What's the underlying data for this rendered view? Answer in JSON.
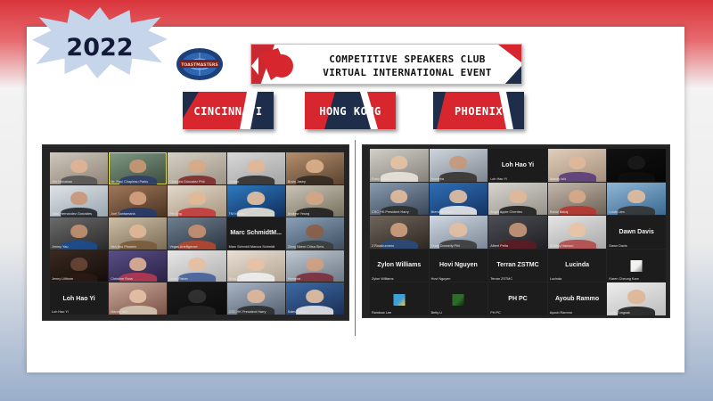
{
  "year": "2022",
  "banner": {
    "line1": "COMPETITIVE SPEAKERS CLUB",
    "line2": "VIRTUAL INTERNATIONAL EVENT"
  },
  "logo_text": "TOASTMASTERS",
  "cities": [
    "CINCINNATI",
    "HONG KONG",
    "PHOENIX"
  ],
  "colors": {
    "red": "#d7262e",
    "navy": "#1e2d4a",
    "dark": "#242424"
  },
  "left_grid": {
    "columns": 5,
    "tiles": [
      {
        "type": "video",
        "caption": "Jim Hinnahan",
        "c1": "#cfc8bd",
        "c2": "#8f8376",
        "sk": "#e0b493",
        "sh": "#555"
      },
      {
        "type": "video",
        "caption": "Mr. Paul Chapleau Parks",
        "c1": "#7f9a84",
        "c2": "#3c4b3e",
        "sk": "#c99873",
        "sh": "#2c3e6a",
        "active": true
      },
      {
        "type": "video",
        "caption": "Chandra Gonzalez Phil",
        "c1": "#d6d0c4",
        "c2": "#9b9385",
        "sk": "#d8aa86",
        "sh": "#7d2a2a"
      },
      {
        "type": "video",
        "caption": "Jordan",
        "c1": "#d8d8d8",
        "c2": "#a3a3a3",
        "sk": "#e2b796",
        "sh": "#2f2f2f"
      },
      {
        "type": "video",
        "caption": "Bram Jasey",
        "c1": "#b58f6c",
        "c2": "#5a4330",
        "sk": "#ddb08d",
        "sh": "#332a22"
      },
      {
        "type": "video",
        "caption": "Nikki Hernandez Gonzales",
        "c1": "#dfe3e6",
        "c2": "#9aa6b0",
        "sk": "#c99577",
        "sh": "#20232b"
      },
      {
        "type": "video",
        "caption": "Joel Santamaria",
        "c1": "#a0785a",
        "c2": "#4a3322",
        "sk": "#d7a282",
        "sh": "#253b6a"
      },
      {
        "type": "video",
        "caption": "Pei Eng",
        "c1": "#e2d8cb",
        "c2": "#a8977f",
        "sk": "#e2b996",
        "sh": "#c23a3a"
      },
      {
        "type": "video",
        "caption": "TM Nanda",
        "c1": "#2f7ac1",
        "c2": "#0f2d5a",
        "sk": "#e8c2a0",
        "sh": "#e8e3d6"
      },
      {
        "type": "video",
        "caption": "Andrew Yeung",
        "c1": "#c9c4b7",
        "c2": "#77715f",
        "sk": "#d4a685",
        "sh": "#1f1f1f"
      },
      {
        "type": "video",
        "caption": "Jimmy Yau",
        "c1": "#6b6b6b",
        "c2": "#2a2a2a",
        "sk": "#c59271",
        "sh": "#1b4b8f"
      },
      {
        "type": "video",
        "caption": "Ven Wui Phoenix",
        "c1": "#cdbfa8",
        "c2": "#7a6b55",
        "sk": "#e2b898",
        "sh": "#7a5a3a"
      },
      {
        "type": "video",
        "caption": "Vegas Artelligence",
        "c1": "#6f7f8f",
        "c2": "#2b3440",
        "sk": "#c99171",
        "sh": "#b6462f"
      },
      {
        "type": "name",
        "big": "Marc SchmidtM...",
        "caption": "Marc Schmidt Marcus Schmidt"
      },
      {
        "type": "video",
        "caption": "Zinny Nkem Chisa Sims",
        "c1": "#8aa1b8",
        "c2": "#3e4e60",
        "sk": "#8c5e45",
        "sh": "#3b3b3b"
      },
      {
        "type": "video",
        "caption": "Jenny Lillitone",
        "c1": "#3a2a22",
        "c2": "#140c08",
        "sk": "#6a4636",
        "sh": "#2a1a14"
      },
      {
        "type": "video",
        "caption": "Christine Ross",
        "c1": "#5a4f86",
        "c2": "#2a2146",
        "sk": "#e0b396",
        "sh": "#b53a52"
      },
      {
        "type": "video",
        "caption": "Brian Fisher",
        "c1": "#e7e7e7",
        "c2": "#b0b0b0",
        "sk": "#e5bfa0",
        "sh": "#425f9a"
      },
      {
        "type": "video",
        "caption": "Ruby Sung",
        "c1": "#e9dfd3",
        "c2": "#b3a594",
        "sk": "#e8c2a4",
        "sh": "#f0f0f0"
      },
      {
        "type": "video",
        "caption": "Homeira",
        "c1": "#bfc9d3",
        "c2": "#6d7985",
        "sk": "#d0a080",
        "sh": "#7c2d3a"
      },
      {
        "type": "name",
        "big": "Loh Hao Yi",
        "caption": "Loh Hao Yi"
      },
      {
        "type": "video",
        "caption": "Mandy Ishi",
        "c1": "#caa79a",
        "c2": "#7a5347",
        "sk": "#e8c2a4",
        "sh": "#d6c6b5"
      },
      {
        "type": "video",
        "caption": "",
        "c1": "#1a1a1a",
        "c2": "#0c0c0c",
        "sk": "#333",
        "sh": "#222"
      },
      {
        "type": "video",
        "caption": "CSC HK President Harry",
        "c1": "#a9b4c4",
        "c2": "#566272",
        "sk": "#e0b89a",
        "sh": "#2b2b2b"
      },
      {
        "type": "video",
        "caption": "Salmon Wilbe",
        "c1": "#3e6aa6",
        "c2": "#1a2f55",
        "sk": "#e7c2a2",
        "sh": "#e6e6e6"
      }
    ]
  },
  "right_grid": {
    "columns": 5,
    "tiles": [
      {
        "type": "video",
        "caption": "Ruby Sung",
        "c1": "#d2cfc9",
        "c2": "#86827b",
        "sk": "#e7c2a2",
        "sh": "#e9e4da"
      },
      {
        "type": "video",
        "caption": "Homeira",
        "c1": "#cfd5dc",
        "c2": "#7d8690",
        "sk": "#c7987a",
        "sh": "#36332f"
      },
      {
        "type": "name",
        "big": "Loh Hao Yi",
        "caption": "Loh Hao Yi"
      },
      {
        "type": "video",
        "caption": "Mandy Ishi",
        "c1": "#e0cdbb",
        "c2": "#a58f7a",
        "sk": "#e0b89a",
        "sh": "#5a3b7a"
      },
      {
        "type": "video",
        "caption": "",
        "c1": "#111",
        "c2": "#050505",
        "sk": "#1a1a1a",
        "sh": "#101010"
      },
      {
        "type": "video",
        "caption": "CSC HK President Harry",
        "c1": "#8a9bb0",
        "c2": "#3a4658",
        "sk": "#e3bc9c",
        "sh": "#2c2c2c"
      },
      {
        "type": "video",
        "caption": "Brendan Wilbe",
        "c1": "#2f6fb5",
        "c2": "#143466",
        "sk": "#e6c1a1",
        "sh": "#eaeaea"
      },
      {
        "type": "video",
        "caption": "Angel Apple Cherries",
        "c1": "#d8d5cf",
        "c2": "#96928a",
        "sk": "#e2b898",
        "sh": "#1f1f1f"
      },
      {
        "type": "video",
        "caption": "Rahul Bakaj",
        "c1": "#c4b9ac",
        "c2": "#6c6155",
        "sk": "#d8aa88",
        "sh": "#b6342f"
      },
      {
        "type": "video",
        "caption": "Louis Lien",
        "c1": "#8fb6d6",
        "c2": "#3b6a92",
        "sk": "#e3bc9c",
        "sh": "#333"
      },
      {
        "type": "video",
        "caption": "2 Roadrunners",
        "c1": "#6f655b",
        "c2": "#2e2822",
        "sk": "#d0a080",
        "sh": "#2a4a7a"
      },
      {
        "type": "video",
        "caption": "Craig Donnelly Phil",
        "c1": "#cfd8e2",
        "c2": "#7c8796",
        "sk": "#e5bfa0",
        "sh": "#3b3b3b"
      },
      {
        "type": "video",
        "caption": "Albert Peña",
        "c1": "#4d4d55",
        "c2": "#1f1f24",
        "sk": "#c9987a",
        "sh": "#5c1c24"
      },
      {
        "type": "video",
        "caption": "Shelley Hanson",
        "c1": "#e5e5e5",
        "c2": "#a8a8a8",
        "sk": "#e8c3a3",
        "sh": "#b34a4a"
      },
      {
        "type": "name",
        "big": "Dawn Davis",
        "caption": "Dawn Davis"
      },
      {
        "type": "name",
        "big": "Zylon Williams",
        "caption": "Zylon Williams"
      },
      {
        "type": "name",
        "big": "Hovi Nguyen",
        "caption": "Hovi Nguyen"
      },
      {
        "type": "name",
        "big": "Terran ZSTMC",
        "caption": "Terran ZSTMC"
      },
      {
        "type": "name",
        "big": "Lucinda",
        "caption": "Lucinda"
      },
      {
        "type": "square",
        "caption": "Karen Cheung Kam",
        "sq": "#f2f2ee",
        "sq2": "#888"
      },
      {
        "type": "square",
        "caption": "Rainbow Lee",
        "sq": "#3e9fd8",
        "sq2": "#f2d14a"
      },
      {
        "type": "square",
        "caption": "Betty Li",
        "sq": "#2e6b2a",
        "sq2": "#0e2b0e"
      },
      {
        "type": "name",
        "big": "PH PC",
        "caption": "PH PC"
      },
      {
        "type": "name",
        "big": "Ayoub Rammo",
        "caption": "Ayoub Rammo"
      },
      {
        "type": "video",
        "caption": "Lalla Tungsak",
        "c1": "#ededed",
        "c2": "#bdbdbd",
        "sk": "#e0b596",
        "sh": "#1d1d1d"
      }
    ]
  }
}
